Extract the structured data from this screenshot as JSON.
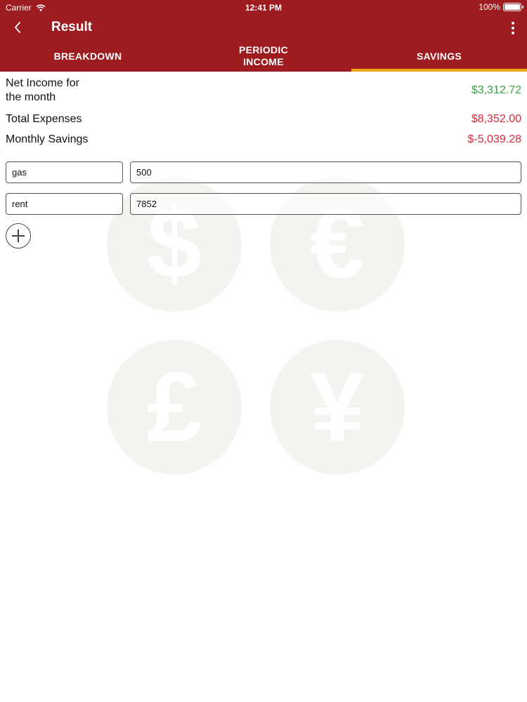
{
  "status_bar": {
    "carrier": "Carrier",
    "time": "12:41 PM",
    "battery": "100%"
  },
  "nav": {
    "title": "Result"
  },
  "tabs": [
    {
      "label": "BREAKDOWN",
      "active": false
    },
    {
      "label": "PERIODIC\nINCOME",
      "active": false
    },
    {
      "label": "SAVINGS",
      "active": true
    }
  ],
  "summary": {
    "net_income_label": "Net Income for the month",
    "net_income_value": "$3,312.72",
    "expenses_label": "Total Expenses",
    "expenses_value": "$8,352.00",
    "savings_label": "Monthly Savings",
    "savings_value": "$-5,039.28"
  },
  "expenses": [
    {
      "name": "gas",
      "amount": "500"
    },
    {
      "name": "rent",
      "amount": "7852"
    }
  ],
  "colors": {
    "brand": "#9e1b20",
    "accent": "#f2a71b",
    "positive": "#3aa346",
    "negative": "#d8283a"
  },
  "icons": {
    "back": "chevron-left-icon",
    "more": "vertical-ellipsis-icon",
    "add": "plus-circle-icon"
  }
}
